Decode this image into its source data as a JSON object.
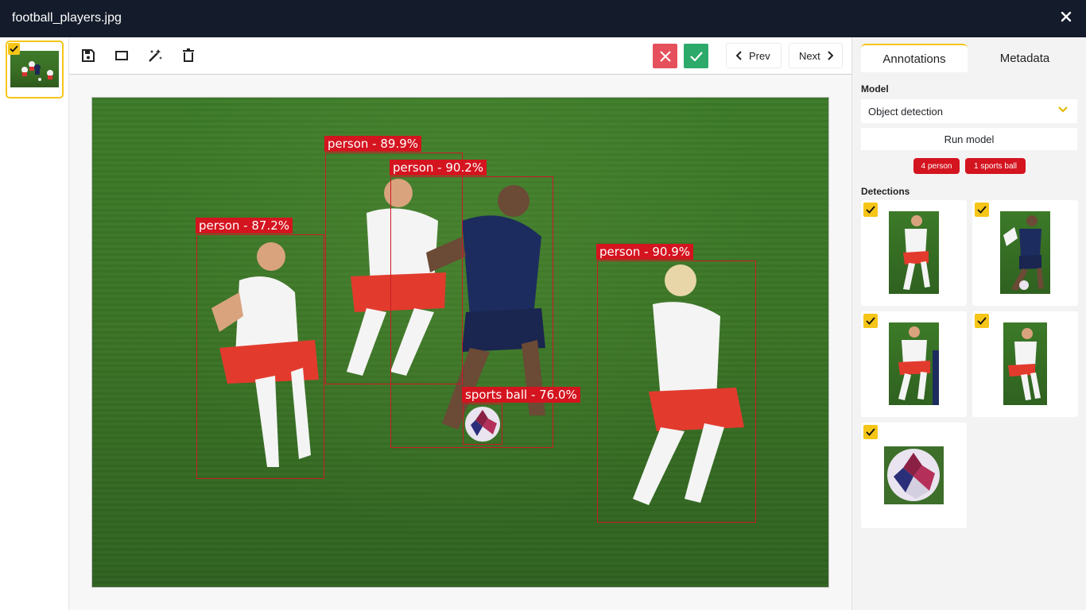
{
  "window": {
    "title": "football_players.jpg",
    "close_icon": "close-icon"
  },
  "thumbnails": [
    {
      "selected": true,
      "checked": true
    }
  ],
  "toolbar": {
    "tools": [
      "save-icon",
      "rectangle-icon",
      "magic-wand-icon",
      "trash-icon"
    ],
    "prev_label": "Prev",
    "next_label": "Next"
  },
  "annotations": [
    {
      "label": "person - 87.2%"
    },
    {
      "label": "person - 89.9%"
    },
    {
      "label": "person - 90.2%"
    },
    {
      "label": "sports ball - 76.0%"
    },
    {
      "label": "person - 90.9%"
    }
  ],
  "panel": {
    "tabs": [
      {
        "label": "Annotations",
        "active": true
      },
      {
        "label": "Metadata",
        "active": false
      }
    ],
    "model_label": "Model",
    "model_value": "Object detection",
    "run_label": "Run model",
    "chips": [
      {
        "label": "4 person"
      },
      {
        "label": "1 sports ball"
      }
    ],
    "detections_label": "Detections",
    "detections": [
      {
        "kind": "person",
        "checked": true
      },
      {
        "kind": "person",
        "checked": true
      },
      {
        "kind": "person",
        "checked": true
      },
      {
        "kind": "person",
        "checked": true
      },
      {
        "kind": "sports ball",
        "checked": true
      }
    ]
  },
  "colors": {
    "titlebar": "#141b2b",
    "accent": "#f5c518",
    "bbox": "#d4141f",
    "reject": "#e5505c",
    "accept": "#2daa6a"
  }
}
